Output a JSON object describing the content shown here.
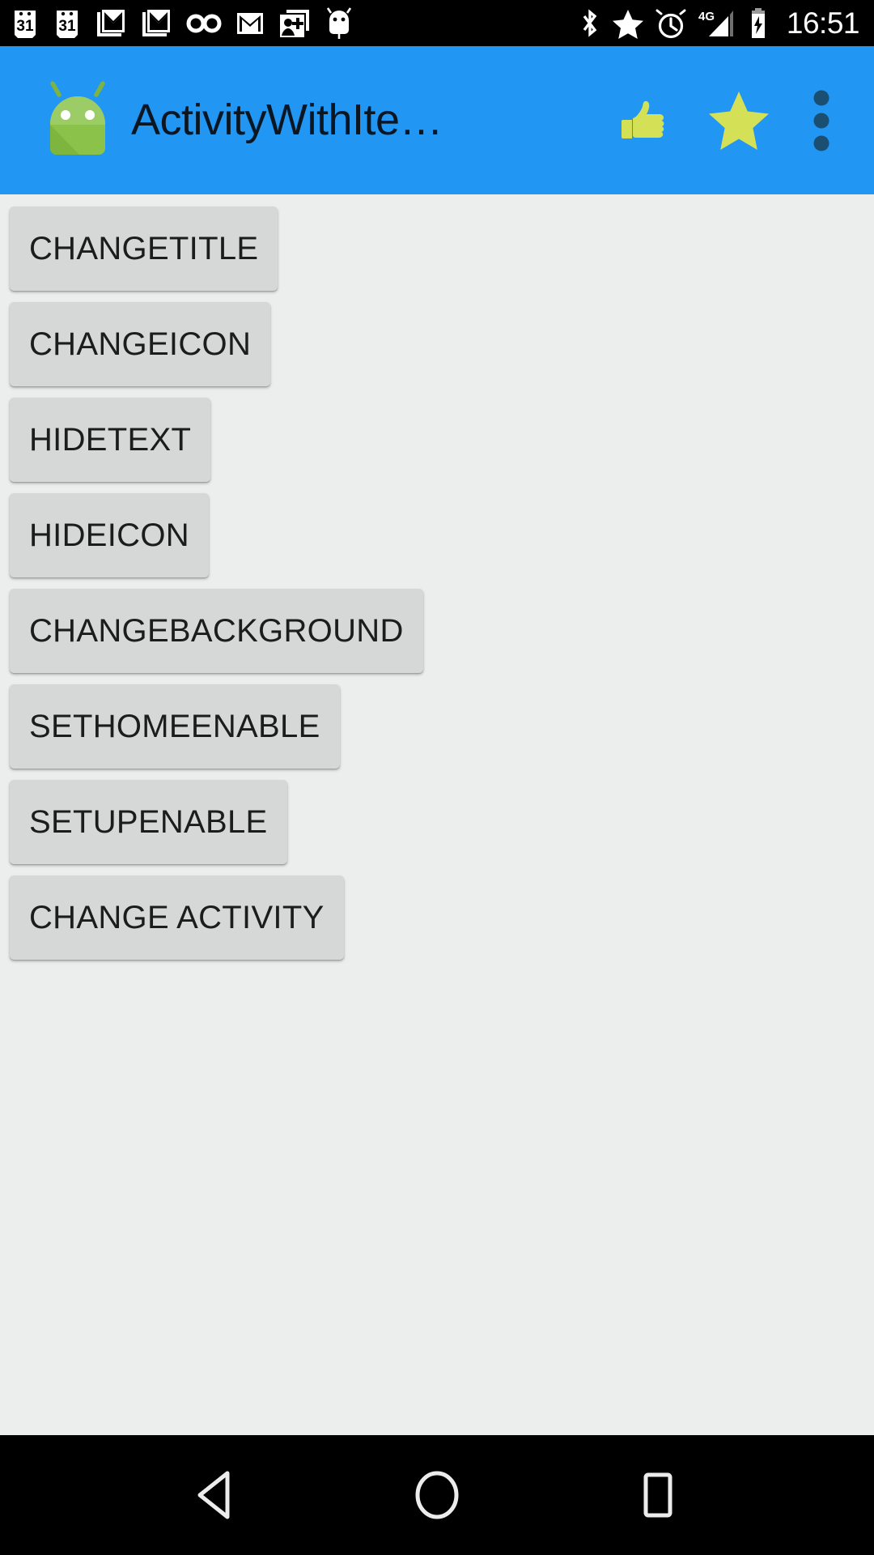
{
  "status_bar": {
    "background": "#000000",
    "clock": "16:51",
    "left_icons": [
      {
        "name": "calendar-icon",
        "label": "31"
      },
      {
        "name": "calendar-icon",
        "label": "31"
      },
      {
        "name": "gmail-stack-icon",
        "label": "M"
      },
      {
        "name": "gmail-stack-icon",
        "label": "M"
      },
      {
        "name": "voicemail-icon",
        "label": "oo"
      },
      {
        "name": "gmail-icon",
        "label": "M"
      },
      {
        "name": "add-contact-icon",
        "label": ""
      },
      {
        "name": "android-debug-icon",
        "label": ""
      }
    ],
    "right_icons": [
      {
        "name": "bluetooth-icon",
        "label": ""
      },
      {
        "name": "star-icon",
        "label": ""
      },
      {
        "name": "alarm-icon",
        "label": ""
      },
      {
        "name": "signal-icon",
        "label": "4G"
      },
      {
        "name": "battery-charging-icon",
        "label": ""
      }
    ]
  },
  "app_bar": {
    "background": "#2196f3",
    "title": "ActivityWithIte…",
    "title_color": "#0a1722",
    "logo_icon": "android-robot-icon",
    "logo_color": "#8bc34a",
    "action_color": "#d4e157",
    "overflow_color": "#1b4f72",
    "actions": [
      {
        "name": "thumb-up-action",
        "label": "thumb-up-icon"
      },
      {
        "name": "star-action",
        "label": "star-icon"
      },
      {
        "name": "overflow-menu-action",
        "label": "more-vert-icon"
      }
    ]
  },
  "content": {
    "background": "#eceded",
    "buttons": [
      {
        "label": "CHANGETITLE",
        "name": "change-title-button"
      },
      {
        "label": "CHANGEICON",
        "name": "change-icon-button"
      },
      {
        "label": "HIDETEXT",
        "name": "hide-text-button"
      },
      {
        "label": "HIDEICON",
        "name": "hide-icon-button"
      },
      {
        "label": "CHANGEBACKGROUND",
        "name": "change-background-button"
      },
      {
        "label": "SETHOMEENABLE",
        "name": "set-home-enable-button"
      },
      {
        "label": "SETUPENABLE",
        "name": "set-up-enable-button"
      },
      {
        "label": "CHANGE ACTIVITY",
        "name": "change-activity-button"
      }
    ]
  },
  "nav_bar": {
    "background": "#000000",
    "icon_color": "#ececec",
    "buttons": [
      {
        "name": "nav-back-button",
        "icon": "back-triangle-icon"
      },
      {
        "name": "nav-home-button",
        "icon": "home-circle-icon"
      },
      {
        "name": "nav-recents-button",
        "icon": "recents-square-icon"
      }
    ]
  }
}
